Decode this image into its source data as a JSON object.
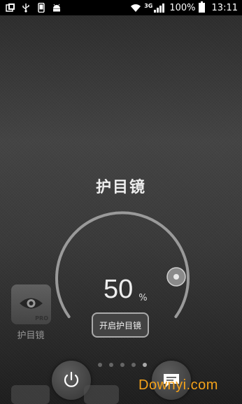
{
  "status_bar": {
    "network_label": "3G",
    "battery_text": "100%",
    "time": "13:11",
    "left_icons": [
      "screenshot-icon",
      "usb-icon",
      "phone-icon",
      "android-icon"
    ],
    "right_icons": [
      "wifi-icon",
      "signal-icon",
      "battery-icon"
    ]
  },
  "main": {
    "title": "护目镜",
    "level_value": "50",
    "level_unit": "%",
    "level_fraction": 0.5,
    "open_button_label": "开启护目镜"
  },
  "background_app": {
    "label": "护目镜",
    "badge": "PRO",
    "icon": "eye-icon"
  },
  "pager": {
    "count": 5,
    "active_index": 4
  },
  "bottom_buttons": [
    {
      "name": "power-button",
      "icon": "power-icon"
    },
    {
      "name": "message-button",
      "icon": "message-icon"
    }
  ],
  "watermark": "Downyi.com"
}
